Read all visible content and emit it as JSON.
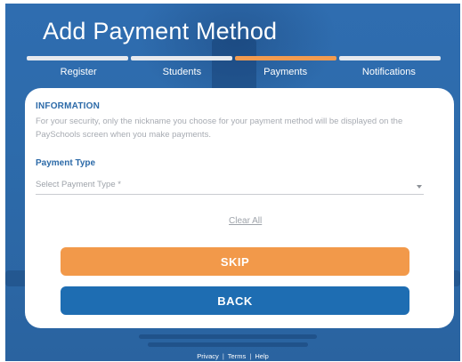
{
  "header": {
    "title": "Add Payment Method"
  },
  "progress": {
    "active_step": 3,
    "total_steps": 4
  },
  "steps": [
    {
      "label": "Register"
    },
    {
      "label": "Students"
    },
    {
      "label": "Payments"
    },
    {
      "label": "Notifications"
    }
  ],
  "information": {
    "heading": "INFORMATION",
    "text": "For your security, only the nickname you choose for your payment method will be displayed on the PaySchools screen when you make payments."
  },
  "payment_type": {
    "label": "Payment Type",
    "placeholder": "Select Payment Type *"
  },
  "actions": {
    "clear_all": "Clear All",
    "skip": "SKIP",
    "back": "BACK"
  },
  "footer": {
    "privacy": "Privacy",
    "separator": "|",
    "terms": "Terms",
    "help": "Help"
  },
  "colors": {
    "background": "#2f6fae",
    "accent_orange": "#f2994a",
    "primary_blue": "#1e6db2",
    "label_blue": "#2c6aa8"
  }
}
